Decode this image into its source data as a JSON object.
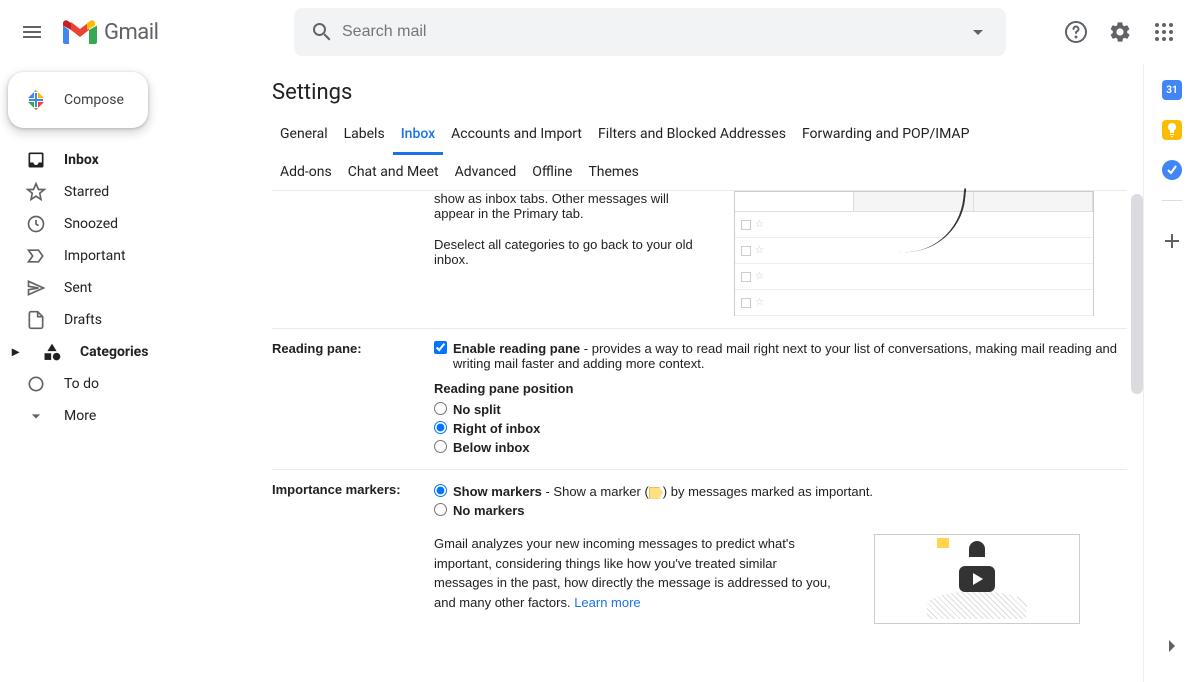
{
  "header": {
    "logo_text": "Gmail",
    "search_placeholder": "Search mail"
  },
  "compose_label": "Compose",
  "sidebar": [
    {
      "icon": "inbox",
      "label": "Inbox",
      "bold": true
    },
    {
      "icon": "star",
      "label": "Starred",
      "bold": false
    },
    {
      "icon": "clock",
      "label": "Snoozed",
      "bold": false
    },
    {
      "icon": "important",
      "label": "Important",
      "bold": false
    },
    {
      "icon": "send",
      "label": "Sent",
      "bold": false
    },
    {
      "icon": "file",
      "label": "Drafts",
      "bold": false
    },
    {
      "icon": "category",
      "label": "Categories",
      "bold": true,
      "expandable": true
    },
    {
      "icon": "circle",
      "label": "To do",
      "bold": false
    },
    {
      "icon": "chevron-down",
      "label": "More",
      "bold": false
    }
  ],
  "page_title": "Settings",
  "tabs_row1": [
    "General",
    "Labels",
    "Inbox",
    "Accounts and Import",
    "Filters and Blocked Addresses",
    "Forwarding and POP/IMAP"
  ],
  "tabs_row2": [
    "Add-ons",
    "Chat and Meet",
    "Advanced",
    "Offline",
    "Themes"
  ],
  "active_tab": "Inbox",
  "categories_section": {
    "text1": "show as inbox tabs. Other messages will appear in the Primary tab.",
    "text2": "Deselect all categories to go back to your old inbox."
  },
  "reading_pane": {
    "label": "Reading pane:",
    "enable_label": "Enable reading pane",
    "enable_desc": " - provides a way to read mail right next to your list of conversations, making mail reading and writing mail faster and adding more context.",
    "enabled": true,
    "position_heading": "Reading pane position",
    "options": [
      {
        "label": "No split",
        "value": "none",
        "bold": true
      },
      {
        "label": "Right of inbox",
        "value": "right",
        "bold": true
      },
      {
        "label": "Below inbox",
        "value": "below",
        "bold": true
      }
    ],
    "selected": "right"
  },
  "importance": {
    "label": "Importance markers:",
    "options": [
      {
        "label_bold": "Show markers",
        "label_rest": " - Show a marker (",
        "label_after": ") by messages marked as important.",
        "value": "show"
      },
      {
        "label_bold": "No markers",
        "label_rest": "",
        "label_after": "",
        "value": "hide"
      }
    ],
    "selected": "show",
    "explain": "Gmail analyzes your new incoming messages to predict what's important, considering things like how you've treated similar messages in the past, how directly the message is addressed to you, and many other factors. ",
    "learn_more": "Learn more"
  },
  "rail": {
    "calendar_day": "31"
  }
}
